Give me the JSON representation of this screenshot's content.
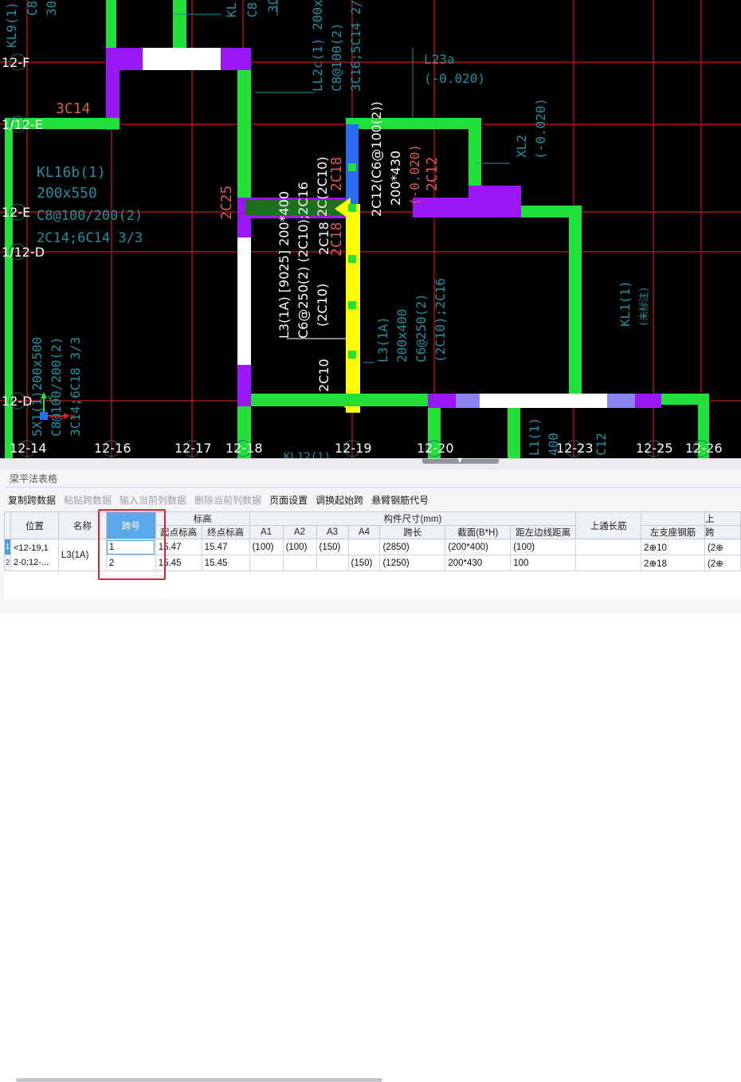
{
  "canvas": {
    "axis_rows": [
      "12-F",
      "1/12-E",
      "12-E",
      "1/12-D",
      "12-D"
    ],
    "axis_cols": [
      "12-14",
      "12-16",
      "12-17",
      "12-18",
      "12-19",
      "12-20",
      "12-23",
      "12-25",
      "12-26"
    ],
    "labels": {
      "kl9_top": "KL9(1)",
      "c8_top": "C8",
      "n30_top": "30",
      "kl_top2": "KL",
      "c8_top2": "C8",
      "n3_top": "3C",
      "ll2c_1": "LL2c(1) 200x",
      "ll2c_2": "C8@100(2)",
      "ll2c_3": "3C16;5C14 2/",
      "l23a_1": "L23a",
      "l23a_2": "(-0.020)",
      "c14_3": "3C14",
      "kl16b_1": "KL16b(1)",
      "kl16b_2": "200x550",
      "kl16b_3": "C8@100/200(2)",
      "kl16b_4": "2C14;6C14 3/3",
      "c25": "2C25",
      "ann_1": "L3(1A) [9025] 200*400",
      "ann_2": "C6@250(2) (2C10);2C16",
      "ann_3": "(2C10)",
      "c18_a": "2C18",
      "c18_b": "2C18",
      "c10_a": "2C(2C10)",
      "c12_a": "2C12(C6@100(2))",
      "dim_200x430": "200*430",
      "n0020": "(-0.020)",
      "c12_b": "2C12",
      "xl2_1": "XL2",
      "xl2_2": "(-0.020)",
      "l3_1": "L3(1A)",
      "l3_2": "200x400",
      "l3_3": "C6@250(2)",
      "l3_4": "(2C10);2C16",
      "kl1_1": "KL1(1)",
      "kl1_2": "(未标注)",
      "c10_b": "2C10",
      "left_v1": "5X1(1)200x500",
      "left_v2": "C8@100/200(2)",
      "left_v3": "3C14;6C18 3/3",
      "kl12": "KL12(1)",
      "bot_l1": "L1(1)",
      "bot_l2": "400",
      "bot_c": "C12"
    },
    "colors": {
      "grid": "#ff1a1a",
      "beam_green": "#22e03a",
      "beam_purple": "#9a16f5",
      "beam_white": "#ffffff",
      "beam_yellow": "#ffff00",
      "beam_blue": "#2a6df0",
      "cyan_text": "#1f8fa0",
      "red_text": "#d75a4a"
    }
  },
  "panel": {
    "title": "梁平法表格",
    "toolbar": [
      {
        "label": "复制跨数据",
        "enabled": true
      },
      {
        "label": "粘贴跨数据",
        "enabled": false
      },
      {
        "label": "输入当前列数据",
        "enabled": false
      },
      {
        "label": "删除当前列数据",
        "enabled": false
      },
      {
        "label": "页面设置",
        "enabled": true
      },
      {
        "label": "调换起始跨",
        "enabled": true
      },
      {
        "label": "悬臂钢筋代号",
        "enabled": true
      }
    ],
    "headers": {
      "position": "位置",
      "name": "名称",
      "span_no": "跨号",
      "elevation": "标高",
      "start_elev": "起点标高",
      "end_elev": "终点标高",
      "dims": "构件尺寸(mm)",
      "a1": "A1",
      "a2": "A2",
      "a3": "A3",
      "a4": "A4",
      "span_len": "跨长",
      "section": "截面(B*H)",
      "edge_dist": "距左边线距离",
      "top_long": "上通长筋",
      "left_support": "左支座钢筋",
      "cut_1": "上",
      "cut_2": "跨"
    },
    "rows": [
      {
        "rownum": "1",
        "position": "<12-19,1",
        "position2": "2-0;12-...",
        "name": "L3(1A)",
        "span_no": "1",
        "start_elev": "15.47",
        "end_elev": "15.47",
        "a1": "(100)",
        "a2": "(100)",
        "a3": "(150)",
        "a4": "",
        "span_len": "(2850)",
        "section": "(200*400)",
        "edge_dist": "(100)",
        "top_long": "",
        "left_support": "2⊕10",
        "next": "(2⊕"
      },
      {
        "rownum": "2",
        "span_no": "2",
        "start_elev": "15.45",
        "end_elev": "15.45",
        "a1": "",
        "a2": "",
        "a3": "",
        "a4": "(150)",
        "span_len": "(1250)",
        "section": "200*430",
        "edge_dist": "100",
        "top_long": "",
        "left_support": "2⊕18",
        "next": "(2⊕"
      }
    ]
  }
}
